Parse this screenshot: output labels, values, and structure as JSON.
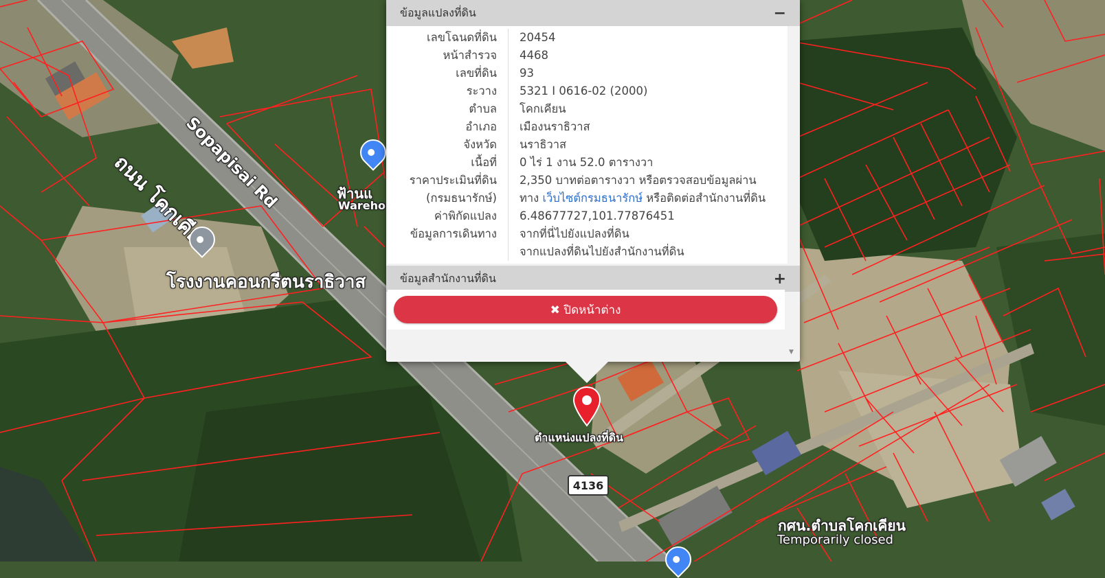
{
  "map": {
    "road_name": "ถนน โคกเคียน",
    "road_name_en": "Sopapisai Rd",
    "poi_concrete": "โรงงานคอนกรีตนราธิวาส",
    "poi_warehouse_th": "ฟ้านแ",
    "poi_warehouse_en": "Wareho",
    "parcel_marker_label": "ตำแหน่งแปลงที่ดิน",
    "route_shield": "4136",
    "poi_office": "กศน.ตำบลโคกเคียน",
    "poi_office_status": "Temporarily closed",
    "parcel_line_color": "#ff2020",
    "marker_color": "#e8202c"
  },
  "popup": {
    "land_info_header": "ข้อมูลแปลงที่ดิน",
    "collapse_symbol": "−",
    "rows": [
      {
        "key": "เลขโฉนดที่ดิน",
        "value": "20454"
      },
      {
        "key": "หน้าสำรวจ",
        "value": "4468"
      },
      {
        "key": "เลขที่ดิน",
        "value": "93"
      },
      {
        "key": "ระวาง",
        "value": "5321 I 0616-02 (2000)"
      },
      {
        "key": "ตำบล",
        "value": "โคกเคียน"
      },
      {
        "key": "อำเภอ",
        "value": "เมืองนราธิวาส"
      },
      {
        "key": "จังหวัด",
        "value": "นราธิวาส"
      },
      {
        "key": "เนื้อที่",
        "value": "0 ไร่ 1 งาน 52.0 ตารางวา"
      }
    ],
    "price_key_1": "ราคาประเมินที่ดิน",
    "price_key_2": "(กรมธนารักษ์)",
    "price_value_1": "2,350 บาทต่อตารางวา หรือตรวจสอบข้อมูลผ่าน",
    "price_value_2_prefix": "ทาง",
    "price_value_2_link": "เว็บไซต์กรมธนารักษ์",
    "price_value_2_suffix": "หรือติดต่อสำนักงานที่ดิน",
    "coord_key": "ค่าพิกัดแปลง",
    "coord_value": "6.48677727,101.77876451",
    "route_key": "ข้อมูลการเดินทาง",
    "route_link_1": "จากที่นี่ไปยังแปลงที่ดิน",
    "route_link_2": "จากแปลงที่ดินไปยังสำนักงานที่ดิน",
    "office_header": "ข้อมูลสำนักงานที่ดิน",
    "expand_symbol": "+",
    "close_label": "✖ ปิดหน้าต่าง"
  }
}
